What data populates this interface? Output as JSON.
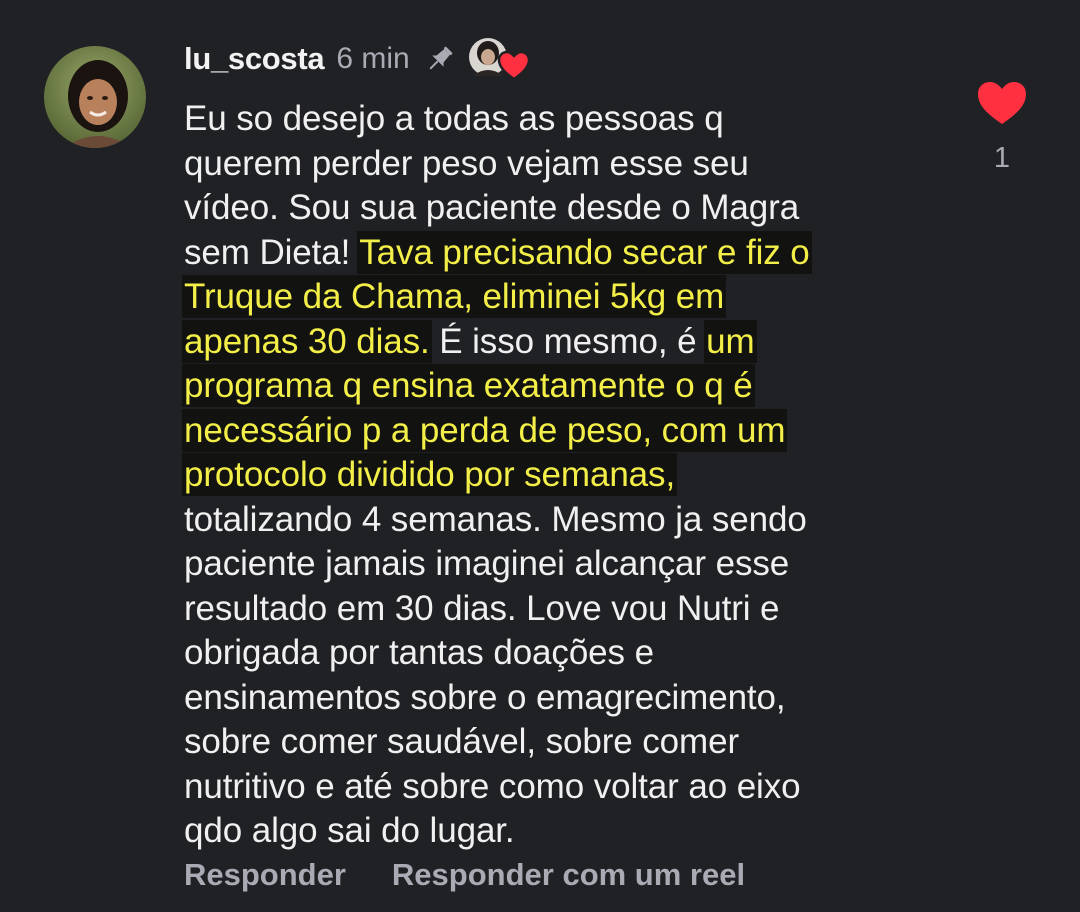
{
  "comment": {
    "username": "lu_scosta",
    "time": "6 min",
    "icons": {
      "pin": "pin-icon",
      "creator_like": "creator-heart-avatar-icon",
      "like": "heart-icon",
      "avatar": "user-avatar"
    },
    "colors": {
      "background": "#202124",
      "text": "#f0f0f0",
      "muted": "#a8abb3",
      "highlight_text": "#f3ef48",
      "like": "#ff3040"
    },
    "text_lines": [
      [
        {
          "t": "Eu so desejo a todas as pessoas q",
          "h": false
        }
      ],
      [
        {
          "t": "querem perder peso vejam esse seu",
          "h": false
        }
      ],
      [
        {
          "t": "vídeo. Sou sua paciente desde o Magra",
          "h": false
        }
      ],
      [
        {
          "t": "sem Dieta! ",
          "h": false
        },
        {
          "t": "Tava precisando secar e fiz o",
          "h": true
        }
      ],
      [
        {
          "t": "Truque da Chama, eliminei 5kg em",
          "h": true
        }
      ],
      [
        {
          "t": "apenas 30 dias.",
          "h": true
        },
        {
          "t": " É isso mesmo, é ",
          "h": false
        },
        {
          "t": "um",
          "h": true
        }
      ],
      [
        {
          "t": "programa q ensina exatamente o q é",
          "h": true
        }
      ],
      [
        {
          "t": "necessário p a perda de peso, com um",
          "h": true
        }
      ],
      [
        {
          "t": "protocolo dividido por semanas,",
          "h": true
        }
      ],
      [
        {
          "t": "totalizando 4 semanas. Mesmo ja sendo",
          "h": false
        }
      ],
      [
        {
          "t": "paciente jamais imaginei alcançar esse",
          "h": false
        }
      ],
      [
        {
          "t": "resultado em 30 dias. Love vou Nutri e",
          "h": false
        }
      ],
      [
        {
          "t": "obrigada por tantas doações e",
          "h": false
        }
      ],
      [
        {
          "t": "ensinamentos sobre o emagrecimento,",
          "h": false
        }
      ],
      [
        {
          "t": "sobre comer saudável, sobre comer",
          "h": false
        }
      ],
      [
        {
          "t": "nutritivo e até sobre como voltar ao eixo",
          "h": false
        }
      ],
      [
        {
          "t": "qdo algo sai do lugar.",
          "h": false
        }
      ]
    ],
    "like_count": "1",
    "actions": {
      "reply": "Responder",
      "reply_reel": "Responder com um reel"
    }
  }
}
